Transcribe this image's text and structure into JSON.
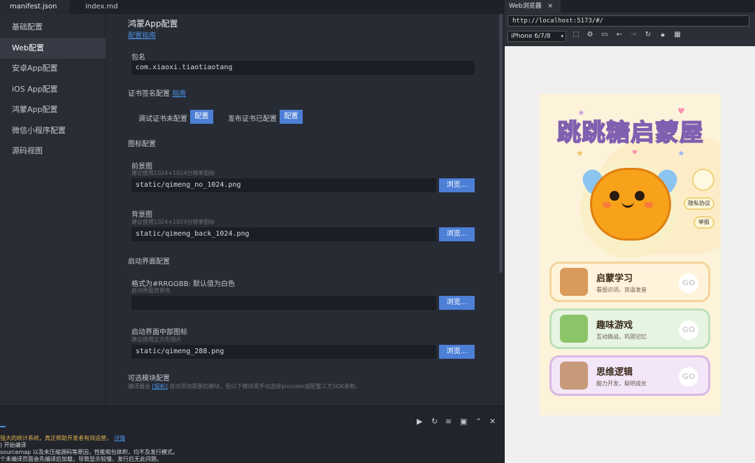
{
  "editor_tabs": [
    "manifest.json",
    "index.md"
  ],
  "nav": [
    "基础配置",
    "Web配置",
    "安卓App配置",
    "iOS App配置",
    "鸿蒙App配置",
    "微信小程序配置",
    "源码视图"
  ],
  "main": {
    "title": "鸿蒙App配置",
    "guide_link": "配置指南",
    "package_label": "包名",
    "package_value": "com.xiaoxi.tiaotiaotang",
    "cert_label": "证书签名配置",
    "cert_link": "指南",
    "debug_cert": "调试证书未配置",
    "release_cert": "发布证书已配置",
    "config_btn": "配置",
    "icon_section": "图标配置",
    "fg_label": "前景图",
    "fg_hint": "建议使用1024×1024分辨率图标",
    "fg_value": "static/qimeng_no_1024.png",
    "bg_label": "背景图",
    "bg_hint": "建议使用1024×1024分辨率图标",
    "bg_value": "static/qimeng_back_1024.png",
    "browse_btn": "浏览...",
    "splash_section": "启动界面配置",
    "color_label": "格式为#RRGGBB: 默认值为白色",
    "color_hint": "启动界面背景色",
    "color_value": "",
    "center_icon_label": "启动界面中部图标",
    "center_icon_hint": "建议使用正方形图片",
    "center_icon_value": "static/qimeng_288.png",
    "modules_section": "可选模块配置",
    "modules_hint_pre": "编译器会",
    "modules_hint_link": "[报析]",
    "modules_hint_post": "自动添加需要的模块，但以下模块需手动选择provider或配置三方SDK参数。"
  },
  "console": {
    "lines": [
      "强大的统计系统，真正帮助开发者有效运营，",
      "开始编译",
      "sourcemap 以及未压缩源码等原因，性能和包体积，均不及发行模式。",
      "个未编译页面会先编译后加载，导致显示较慢，发行后无此问题。"
    ],
    "detail_link": "详情",
    "tool_icons": [
      "play-icon",
      "restart-icon",
      "clear-icon",
      "terminal-icon",
      "chevron-up-icon",
      "close-icon"
    ]
  },
  "browser": {
    "tab_title": "Web浏览器",
    "tab_close": "×",
    "url": "http://localhost:5173/#/",
    "device": "iPhone 6/7/8",
    "icons": [
      "screenshot-icon",
      "settings-icon",
      "devtools-icon",
      "back-icon",
      "forward-icon",
      "refresh-icon",
      "lock-icon",
      "qr-icon"
    ]
  },
  "app": {
    "title": "跳跳糖启蒙屋",
    "privacy": "隐私协议",
    "report": "举报",
    "cards": [
      {
        "title": "启蒙学习",
        "sub": "看图识词，双语发音",
        "go": "GO",
        "border": "#f3d59a",
        "bg": "#fff3dc"
      },
      {
        "title": "趣味游戏",
        "sub": "互动挑战，巩固记忆",
        "go": "GO",
        "border": "#bde0b8",
        "bg": "#e6f4e2"
      },
      {
        "title": "思维逻辑",
        "sub": "脑力开发，聪明成长",
        "go": "GO",
        "border": "#d8b8e6",
        "bg": "#f3e6f8"
      }
    ]
  }
}
